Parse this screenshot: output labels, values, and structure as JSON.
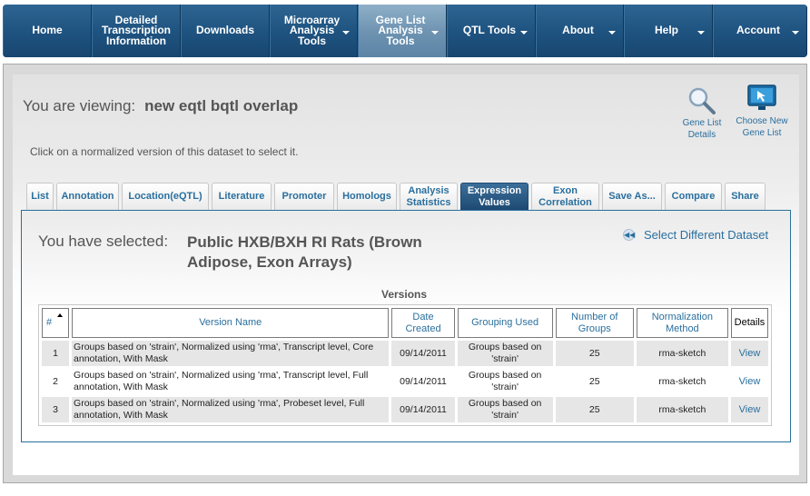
{
  "nav": {
    "items": [
      {
        "label": "Home",
        "caret": false,
        "active": false
      },
      {
        "label": "Detailed Transcription Information",
        "caret": false,
        "active": false
      },
      {
        "label": "Downloads",
        "caret": false,
        "active": false
      },
      {
        "label": "Microarray Analysis Tools",
        "caret": true,
        "active": false
      },
      {
        "label": "Gene List Analysis Tools",
        "caret": true,
        "active": true
      },
      {
        "label": "QTL Tools",
        "caret": true,
        "active": false
      },
      {
        "label": "About",
        "caret": true,
        "active": false
      },
      {
        "label": "Help",
        "caret": true,
        "active": false
      },
      {
        "label": "Account",
        "caret": true,
        "active": false
      }
    ]
  },
  "header": {
    "viewing_prefix": "You are viewing:",
    "viewing_name": "new eqtl bqtl overlap",
    "instruction": "Click on a normalized version of this dataset to select it."
  },
  "tools": {
    "details": "Gene List Details",
    "choose": "Choose New Gene List"
  },
  "tabs": [
    {
      "label": "List",
      "active": false
    },
    {
      "label": "Annotation",
      "active": false
    },
    {
      "label": "Location(eQTL)",
      "active": false
    },
    {
      "label": "Literature",
      "active": false
    },
    {
      "label": "Promoter",
      "active": false
    },
    {
      "label": "Homologs",
      "active": false
    },
    {
      "label": "Analysis Statistics",
      "active": false
    },
    {
      "label": "Expression Values",
      "active": true
    },
    {
      "label": "Exon Correlation",
      "active": false
    },
    {
      "label": "Save As...",
      "active": false
    },
    {
      "label": "Compare",
      "active": false
    },
    {
      "label": "Share",
      "active": false
    }
  ],
  "selection": {
    "prefix": "You have selected:",
    "dataset": "Public HXB/BXH RI Rats (Brown Adipose, Exon Arrays)",
    "select_different": "Select Different Dataset"
  },
  "versions": {
    "title": "Versions",
    "columns": [
      "#",
      "Version Name",
      "Date Created",
      "Grouping Used",
      "Number of Groups",
      "Normalization Method",
      "Details"
    ],
    "rows": [
      {
        "num": "1",
        "name": "Groups based on 'strain', Normalized using 'rma', Transcript level, Core annotation, With Mask",
        "date": "09/14/2011",
        "grouping": "Groups based on 'strain'",
        "groups": "25",
        "method": "rma-sketch",
        "details": "View"
      },
      {
        "num": "2",
        "name": "Groups based on 'strain', Normalized using 'rma', Transcript level, Full annotation, With Mask",
        "date": "09/14/2011",
        "grouping": "Groups based on 'strain'",
        "groups": "25",
        "method": "rma-sketch",
        "details": "View"
      },
      {
        "num": "3",
        "name": "Groups based on 'strain', Normalized using 'rma', Probeset level, Full annotation, With Mask",
        "date": "09/14/2011",
        "grouping": "Groups based on 'strain'",
        "groups": "25",
        "method": "rma-sketch",
        "details": "View"
      }
    ]
  }
}
